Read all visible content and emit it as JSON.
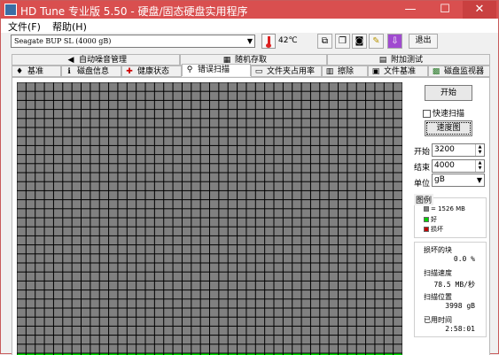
{
  "window": {
    "title": "HD Tune 专业版 5.50 - 硬盘/固态硬盘实用程序",
    "minimize": "—",
    "maximize": "☐",
    "close": "✕"
  },
  "menu": {
    "file": "文件(F)",
    "help": "帮助(H)"
  },
  "toolbar": {
    "drive": "Seagate BUP SL (4000 gB)",
    "temperature": "42℃",
    "exit_label": "退出",
    "icons": [
      "copy-info-icon",
      "copy-screen-icon",
      "screenshot-icon",
      "options-icon",
      "download-icon"
    ]
  },
  "tabs_top": [
    {
      "label": "自动噪音管理",
      "icon": "speaker-icon"
    },
    {
      "label": "随机存取",
      "icon": "random-access-icon"
    },
    {
      "label": "附加测试",
      "icon": "extra-tests-icon"
    }
  ],
  "tabs_bottom": [
    {
      "label": "基准",
      "icon": "benchmark-icon"
    },
    {
      "label": "磁盘信息",
      "icon": "info-icon"
    },
    {
      "label": "健康状态",
      "icon": "health-icon"
    },
    {
      "label": "错误扫描",
      "icon": "search-icon",
      "active": true
    },
    {
      "label": "文件夹占用率",
      "icon": "folder-icon"
    },
    {
      "label": "擦除",
      "icon": "erase-icon"
    },
    {
      "label": "文件基准",
      "icon": "file-benchmark-icon"
    },
    {
      "label": "磁盘监视器",
      "icon": "monitor-icon"
    }
  ],
  "controls": {
    "start_button": "开始",
    "quick_scan_label": "快速扫描",
    "quick_scan_checked": false,
    "speed_map_button": "速度图",
    "start_label": "开始",
    "start_value": "3200",
    "end_label": "结束",
    "end_value": "4000",
    "unit_label": "单位",
    "unit_value": "gB",
    "spin_up": "▲",
    "spin_down": "▼",
    "dropdown_arrow": "▼"
  },
  "legend": {
    "title": "图例",
    "block_size": "= 1526 MB",
    "good": "好",
    "bad": "损坏",
    "colors": {
      "block": "#808080",
      "good": "#00d000",
      "bad": "#c00000"
    }
  },
  "stats": {
    "damaged_label": "损坏的块",
    "damaged_value": "0.0 %",
    "speed_label": "扫描速度",
    "speed_value": "78.5 MB/秒",
    "position_label": "扫描位置",
    "position_value": "3998 gB",
    "elapsed_label": "已用时间",
    "elapsed_value": "2:58:01"
  },
  "scan_grid": {
    "columns": 42,
    "visible_rows": 30,
    "scanned_rows_at_bottom": 1,
    "colors": {
      "unscanned": "#808080",
      "scanned": "#00e000",
      "border": "#000000"
    }
  }
}
